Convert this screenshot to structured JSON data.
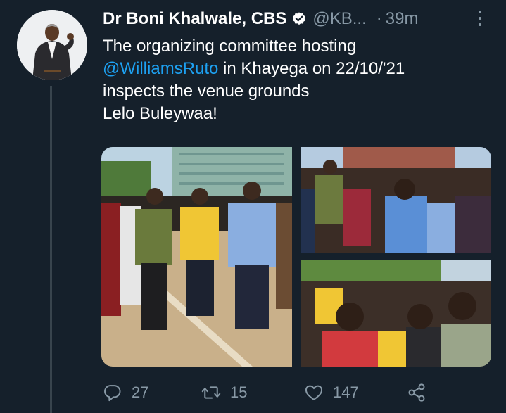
{
  "tweet": {
    "author_name": "Dr Boni Khalwale, CBS",
    "handle": "@KB...",
    "separator": "·",
    "time": "39m",
    "text_line1": "The organizing committee hosting",
    "mention": "@WilliamsRuto",
    "text_line2_rest": " in Khayega on 22/10/'21",
    "text_line3": "inspects the venue grounds",
    "text_line4": "Lelo Buleywaa!"
  },
  "actions": {
    "replies": "27",
    "retweets": "15",
    "likes": "147"
  },
  "icons": {
    "verified": "verified-badge-icon",
    "more": "more-icon",
    "reply": "reply-icon",
    "retweet": "retweet-icon",
    "like": "heart-icon",
    "share": "share-icon"
  },
  "colors": {
    "background": "#15202b",
    "text": "#ffffff",
    "secondary": "#8899a6",
    "link": "#1da1f2",
    "thread_line": "#38444d"
  }
}
